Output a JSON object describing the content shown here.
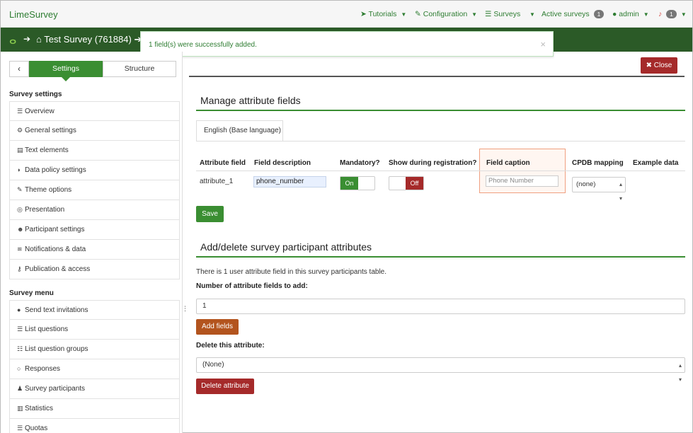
{
  "topnav": {
    "brand": "LimeSurvey",
    "tutorials": "Tutorials",
    "configuration": "Configuration",
    "surveys": "Surveys",
    "active_surveys": "Active surveys",
    "active_surveys_count": "1",
    "admin": "admin",
    "notifications_count": "1"
  },
  "surveybar": {
    "title": "Test Survey (761884)"
  },
  "alert": {
    "message": "1 field(s) were successfully added.",
    "close": "×"
  },
  "sidebar": {
    "tab_settings": "Settings",
    "tab_structure": "Structure",
    "survey_settings_title": "Survey settings",
    "survey_settings_items": [
      {
        "label": "Overview",
        "icon": "list-icon"
      },
      {
        "label": "General settings",
        "icon": "gears-icon"
      },
      {
        "label": "Text elements",
        "icon": "file-text-icon"
      },
      {
        "label": "Data policy settings",
        "icon": "shield-icon"
      },
      {
        "label": "Theme options",
        "icon": "paintbrush-icon"
      },
      {
        "label": "Presentation",
        "icon": "eye-slash-icon"
      },
      {
        "label": "Participant settings",
        "icon": "users-icon"
      },
      {
        "label": "Notifications & data",
        "icon": "rss-icon"
      },
      {
        "label": "Publication & access",
        "icon": "key-icon"
      }
    ],
    "survey_menu_title": "Survey menu",
    "survey_menu_items": [
      {
        "label": "Send text invitations",
        "icon": "comment-icon"
      },
      {
        "label": "List questions",
        "icon": "list-icon"
      },
      {
        "label": "List question groups",
        "icon": "th-list-icon"
      },
      {
        "label": "Responses",
        "icon": "comment-outline-icon"
      },
      {
        "label": "Survey participants",
        "icon": "user-icon"
      },
      {
        "label": "Statistics",
        "icon": "bar-chart-icon"
      },
      {
        "label": "Quotas",
        "icon": "list-icon"
      }
    ]
  },
  "main": {
    "close_label": "Close",
    "manage_title": "Manage attribute fields",
    "language_tab": "English (Base language)",
    "table": {
      "headers": [
        "Attribute field",
        "Field description",
        "Mandatory?",
        "Show during registration?",
        "Field caption",
        "CPDB mapping",
        "Example data"
      ],
      "row": {
        "attribute": "attribute_1",
        "description": "phone_number",
        "mandatory": "On",
        "show_registration": "Off",
        "caption_placeholder": "Phone Number",
        "cpdb": "(none)",
        "example": ""
      }
    },
    "save_label": "Save",
    "adddel_title": "Add/delete survey participant attributes",
    "info_text": "There is 1 user attribute field in this survey participants table.",
    "num_fields_label": "Number of attribute fields to add:",
    "num_fields_value": "1",
    "add_fields_label": "Add fields",
    "delete_label": "Delete this attribute:",
    "delete_select": "(None)",
    "delete_button": "Delete attribute"
  }
}
